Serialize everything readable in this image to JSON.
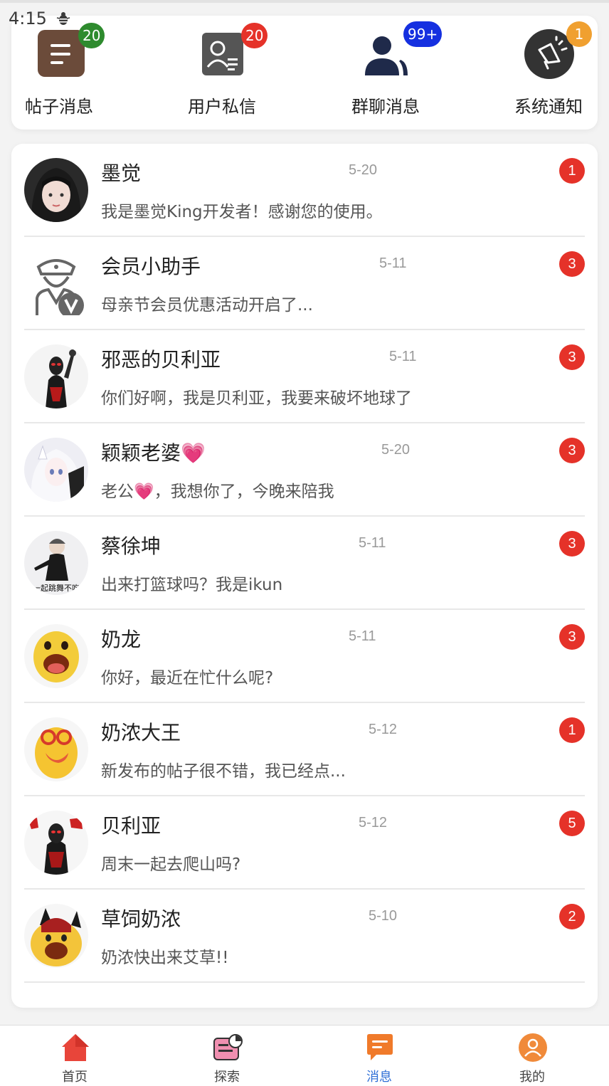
{
  "status": {
    "time": "4:15"
  },
  "categories": [
    {
      "label": "帖子消息",
      "badge": "20",
      "badge_color": "#2e8b2e",
      "icon": "post-list-icon"
    },
    {
      "label": "用户私信",
      "badge": "20",
      "badge_color": "#e53229",
      "icon": "user-message-icon"
    },
    {
      "label": "群聊消息",
      "badge": "99+",
      "badge_color": "#1530e0",
      "icon": "group-chat-icon"
    },
    {
      "label": "系统通知",
      "badge": "1",
      "badge_color": "#f0a030",
      "icon": "megaphone-icon"
    }
  ],
  "conversations": [
    {
      "name": "墨觉",
      "time": "5-20",
      "message": "我是墨觉King开发者！感谢您的使用。",
      "unread": "1"
    },
    {
      "name": "会员小助手",
      "time": "5-11",
      "message": "母亲节会员优惠活动开启了...",
      "unread": "3"
    },
    {
      "name": "邪恶的贝利亚",
      "time": "5-11",
      "message": "你们好啊，我是贝利亚，我要来破坏地球了",
      "unread": "3"
    },
    {
      "name": "颖颖老婆💗",
      "time": "5-20",
      "message": "老公💗，我想你了，今晚来陪我",
      "unread": "3"
    },
    {
      "name": "蔡徐坤",
      "time": "5-11",
      "message": "出来打篮球吗？我是ikun",
      "unread": "3"
    },
    {
      "name": "奶龙",
      "time": "5-11",
      "message": "你好，最近在忙什么呢?",
      "unread": "3"
    },
    {
      "name": "奶浓大王",
      "time": "5-12",
      "message": "新发布的帖子很不错，我已经点...",
      "unread": "1"
    },
    {
      "name": "贝利亚",
      "time": "5-12",
      "message": "周末一起去爬山吗?",
      "unread": "5"
    },
    {
      "name": "草饲奶浓",
      "time": "5-10",
      "message": "奶浓快出来艾草!!",
      "unread": "2"
    }
  ],
  "avatar_texts": {
    "cai": "一起跳舞不吃"
  },
  "nav": [
    {
      "label": "首页",
      "icon": "home-icon"
    },
    {
      "label": "探索",
      "icon": "explore-icon"
    },
    {
      "label": "消息",
      "icon": "message-icon",
      "active": true
    },
    {
      "label": "我的",
      "icon": "profile-icon"
    }
  ],
  "colors": {
    "badge_red": "#e53229",
    "active_nav": "#2f6fd6",
    "time_gray": "#999999"
  }
}
